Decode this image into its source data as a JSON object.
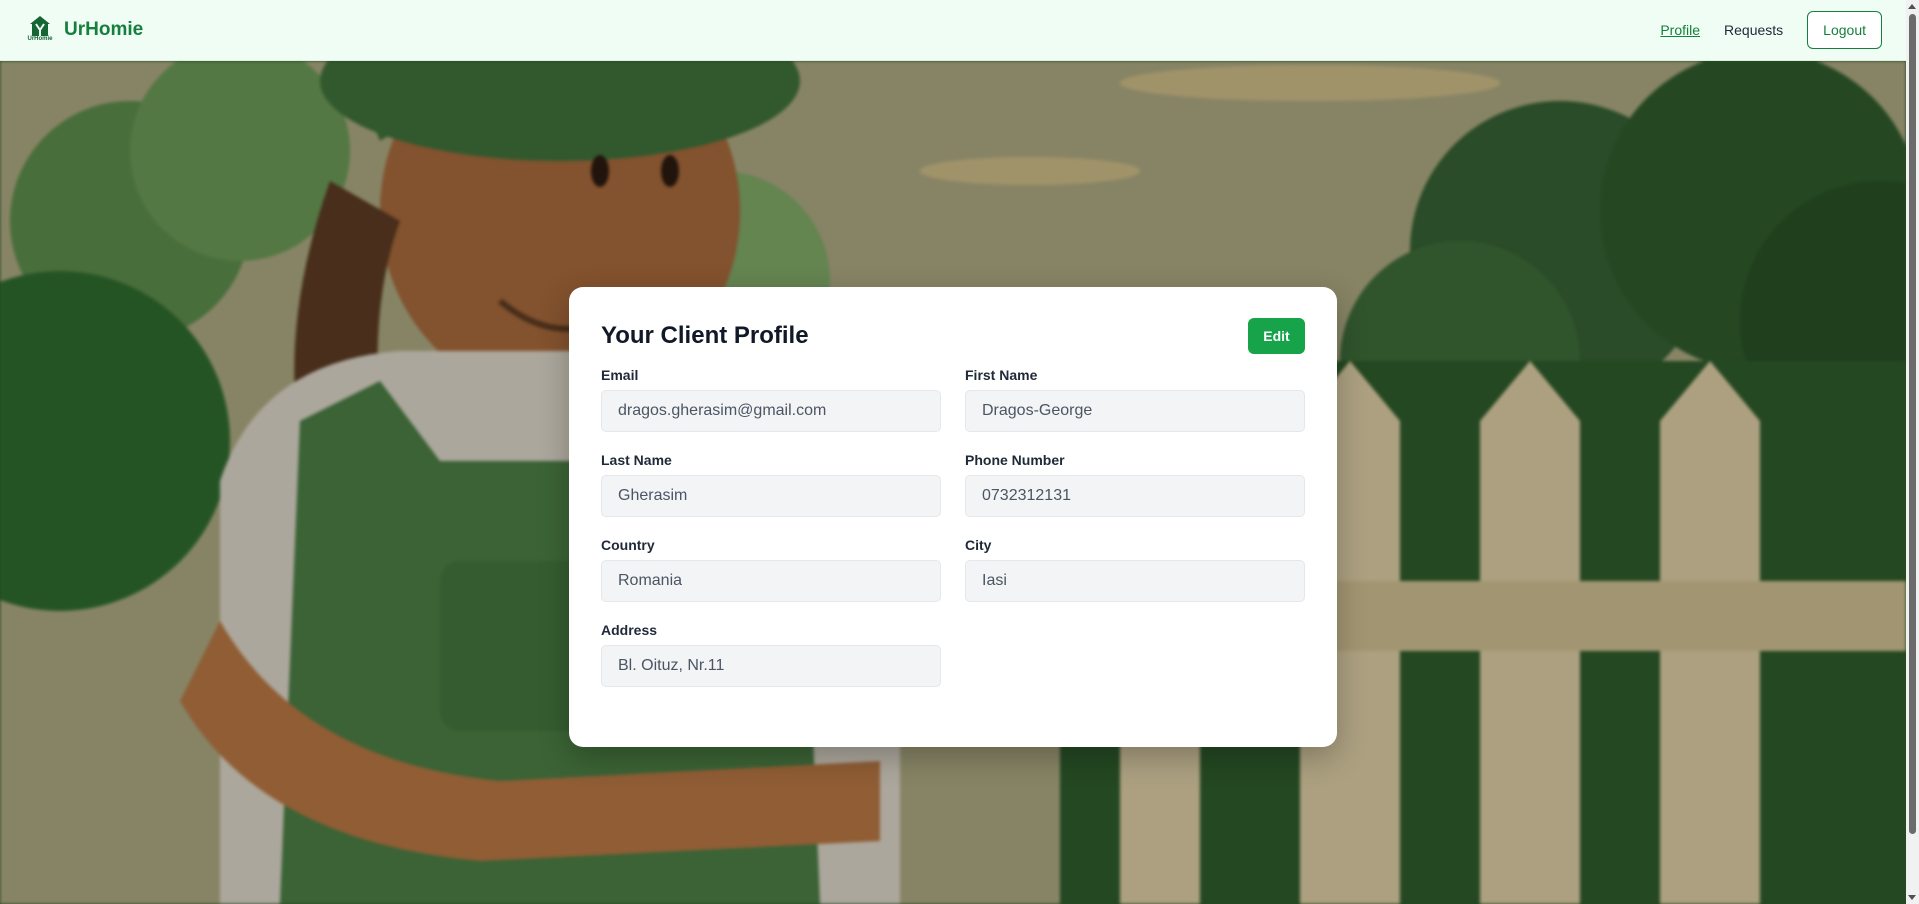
{
  "header": {
    "brand_name": "UrHomie",
    "logo_caption": "UrHomie",
    "nav": [
      {
        "label": "Profile",
        "active": true
      },
      {
        "label": "Requests",
        "active": false
      }
    ],
    "logout_label": "Logout"
  },
  "profile": {
    "title": "Your Client Profile",
    "edit_label": "Edit",
    "fields": {
      "email": {
        "label": "Email",
        "value": "dragos.gherasim@gmail.com"
      },
      "first_name": {
        "label": "First Name",
        "value": "Dragos-George"
      },
      "last_name": {
        "label": "Last Name",
        "value": "Gherasim"
      },
      "phone": {
        "label": "Phone Number",
        "value": "0732312131"
      },
      "country": {
        "label": "Country",
        "value": "Romania"
      },
      "city": {
        "label": "City",
        "value": "Iasi"
      },
      "address": {
        "label": "Address",
        "value": "Bl. Oituz, Nr.11"
      }
    }
  },
  "colors": {
    "brand": "#15803d",
    "header_bg": "#f0fdf4",
    "edit_button": "#16a34a",
    "input_bg": "#f3f4f6"
  },
  "icons": {
    "logo": "house-icon"
  }
}
